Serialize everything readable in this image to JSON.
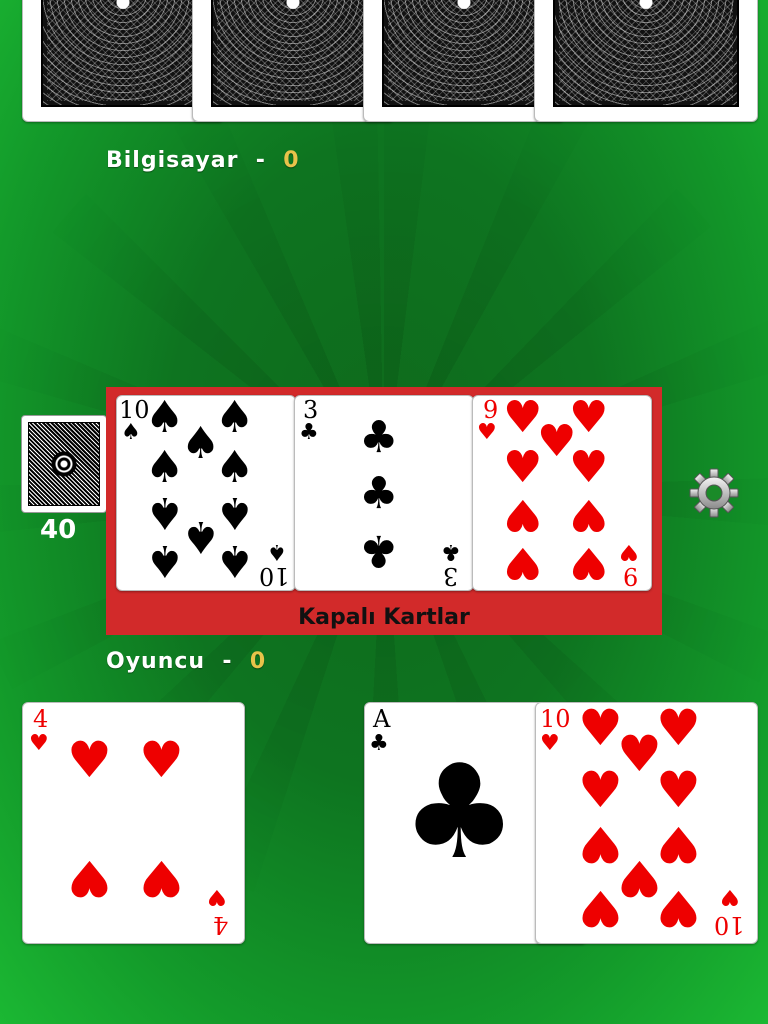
{
  "opponent": {
    "name": "Bilgisayar",
    "separator": "-",
    "score": "0"
  },
  "player": {
    "name": "Oyuncu",
    "separator": "-",
    "score": "0"
  },
  "deck": {
    "count": "40"
  },
  "center": {
    "caption": "Kapalı Kartlar",
    "cards": [
      {
        "rank": "10",
        "suit": "spade",
        "symbol": "♠",
        "color": "black"
      },
      {
        "rank": "3",
        "suit": "club",
        "symbol": "♣",
        "color": "black"
      },
      {
        "rank": "9",
        "suit": "heart",
        "symbol": "♥",
        "color": "red"
      }
    ]
  },
  "hand": [
    {
      "rank": "4",
      "suit": "heart",
      "symbol": "♥",
      "color": "red"
    },
    {
      "rank": "A",
      "suit": "club",
      "symbol": "♣",
      "color": "black"
    },
    {
      "rank": "10",
      "suit": "heart",
      "symbol": "♥",
      "color": "red"
    }
  ],
  "icons": {
    "settings": "gear-icon"
  },
  "colors": {
    "table_green": "#0e7420",
    "panel_red": "#d22a2a",
    "score_gold": "#e8c34a"
  }
}
